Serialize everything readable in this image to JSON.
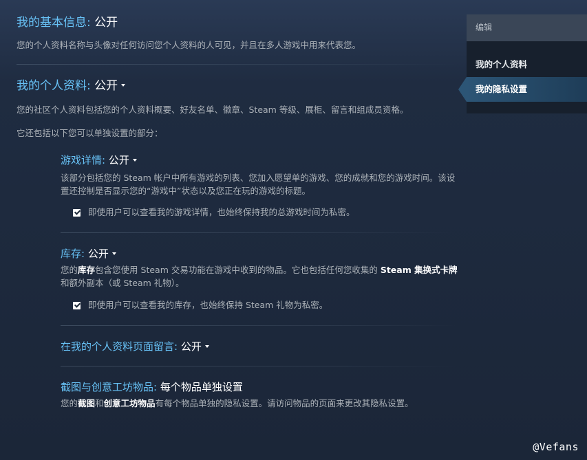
{
  "basic_info": {
    "label": "我的基本信息:",
    "value": "公开",
    "description": "您的个人资料名称与头像对任何访问您个人资料的人可见，并且在多人游戏中用来代表您。"
  },
  "profile": {
    "label": "我的个人资料:",
    "value": "公开",
    "description": "您的社区个人资料包括您的个人资料概要、好友名单、徽章、Steam 等级、展柜、留言和组成员资格。",
    "sub_intro": "它还包括以下您可以单独设置的部分："
  },
  "game_details": {
    "label": "游戏详情:",
    "value": "公开",
    "description": "该部分包括您的 Steam 帐户中所有游戏的列表、您加入愿望单的游戏、您的成就和您的游戏时间。该设置还控制是否显示您的“游戏中”状态以及您正在玩的游戏的标题。",
    "checkbox_label": "即使用户可以查看我的游戏详情，也始终保持我的总游戏时间为私密。",
    "checkbox_checked": true
  },
  "inventory": {
    "label": "库存:",
    "value": "公开",
    "desc_part1": "您的",
    "desc_bold1": "库存",
    "desc_part2": "包含您使用 Steam 交易功能在游戏中收到的物品。它也包括任何您收集的 ",
    "desc_bold2": "Steam 集换式卡牌",
    "desc_part3": "和额外副本（或 Steam 礼物）。",
    "checkbox_label": "即使用户可以查看我的库存，也始终保持 Steam 礼物为私密。",
    "checkbox_checked": true
  },
  "comments": {
    "label": "在我的个人资料页面留言:",
    "value": "公开"
  },
  "screenshots": {
    "label": "截图与创意工坊物品:",
    "value": "每个物品单独设置",
    "desc_part1": "您的",
    "desc_bold1": "截图",
    "desc_part2": "和",
    "desc_bold2": "创意工坊物品",
    "desc_part3": "有每个物品单独的隐私设置。请访问物品的页面来更改其隐私设置。"
  },
  "sidebar": {
    "header": "编辑",
    "items": [
      {
        "label": "我的个人资料",
        "active": false
      },
      {
        "label": "我的隐私设置",
        "active": true
      }
    ]
  },
  "watermark": "@Vefans",
  "colors": {
    "label_blue": "#67c1f5",
    "value_white": "#ffffff",
    "text_gray": "#acb2b8",
    "sidebar_active": "#2c5576"
  }
}
